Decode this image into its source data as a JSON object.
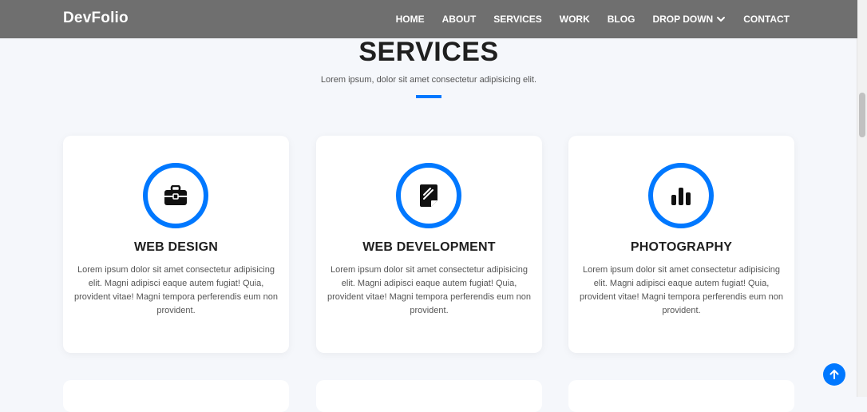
{
  "header": {
    "brand": "DevFolio",
    "nav": [
      {
        "label": "HOME"
      },
      {
        "label": "ABOUT"
      },
      {
        "label": "SERVICES"
      },
      {
        "label": "WORK"
      },
      {
        "label": "BLOG"
      },
      {
        "label": "DROP DOWN"
      },
      {
        "label": "CONTACT"
      }
    ]
  },
  "section": {
    "title": "SERVICES",
    "subtitle": "Lorem ipsum, dolor sit amet consectetur adipisicing elit.",
    "accent_color": "#0078ff"
  },
  "services": [
    {
      "icon": "briefcase-icon",
      "title": "WEB DESIGN",
      "description": "Lorem ipsum dolor sit amet consectetur adipisicing elit. Magni adipisci eaque autem fugiat! Quia, provident vitae! Magni tempora perferendis eum non provident."
    },
    {
      "icon": "document-edit-icon",
      "title": "WEB DEVELOPMENT",
      "description": "Lorem ipsum dolor sit amet consectetur adipisicing elit. Magni adipisci eaque autem fugiat! Quia, provident vitae! Magni tempora perferendis eum non provident."
    },
    {
      "icon": "bar-chart-icon",
      "title": "PHOTOGRAPHY",
      "description": "Lorem ipsum dolor sit amet consectetur adipisicing elit. Magni adipisci eaque autem fugiat! Quia, provident vitae! Magni tempora perferendis eum non provident."
    }
  ],
  "colors": {
    "header_bg": "#6f6f6f",
    "page_bg": "#f5f7fb",
    "accent": "#0078ff"
  }
}
